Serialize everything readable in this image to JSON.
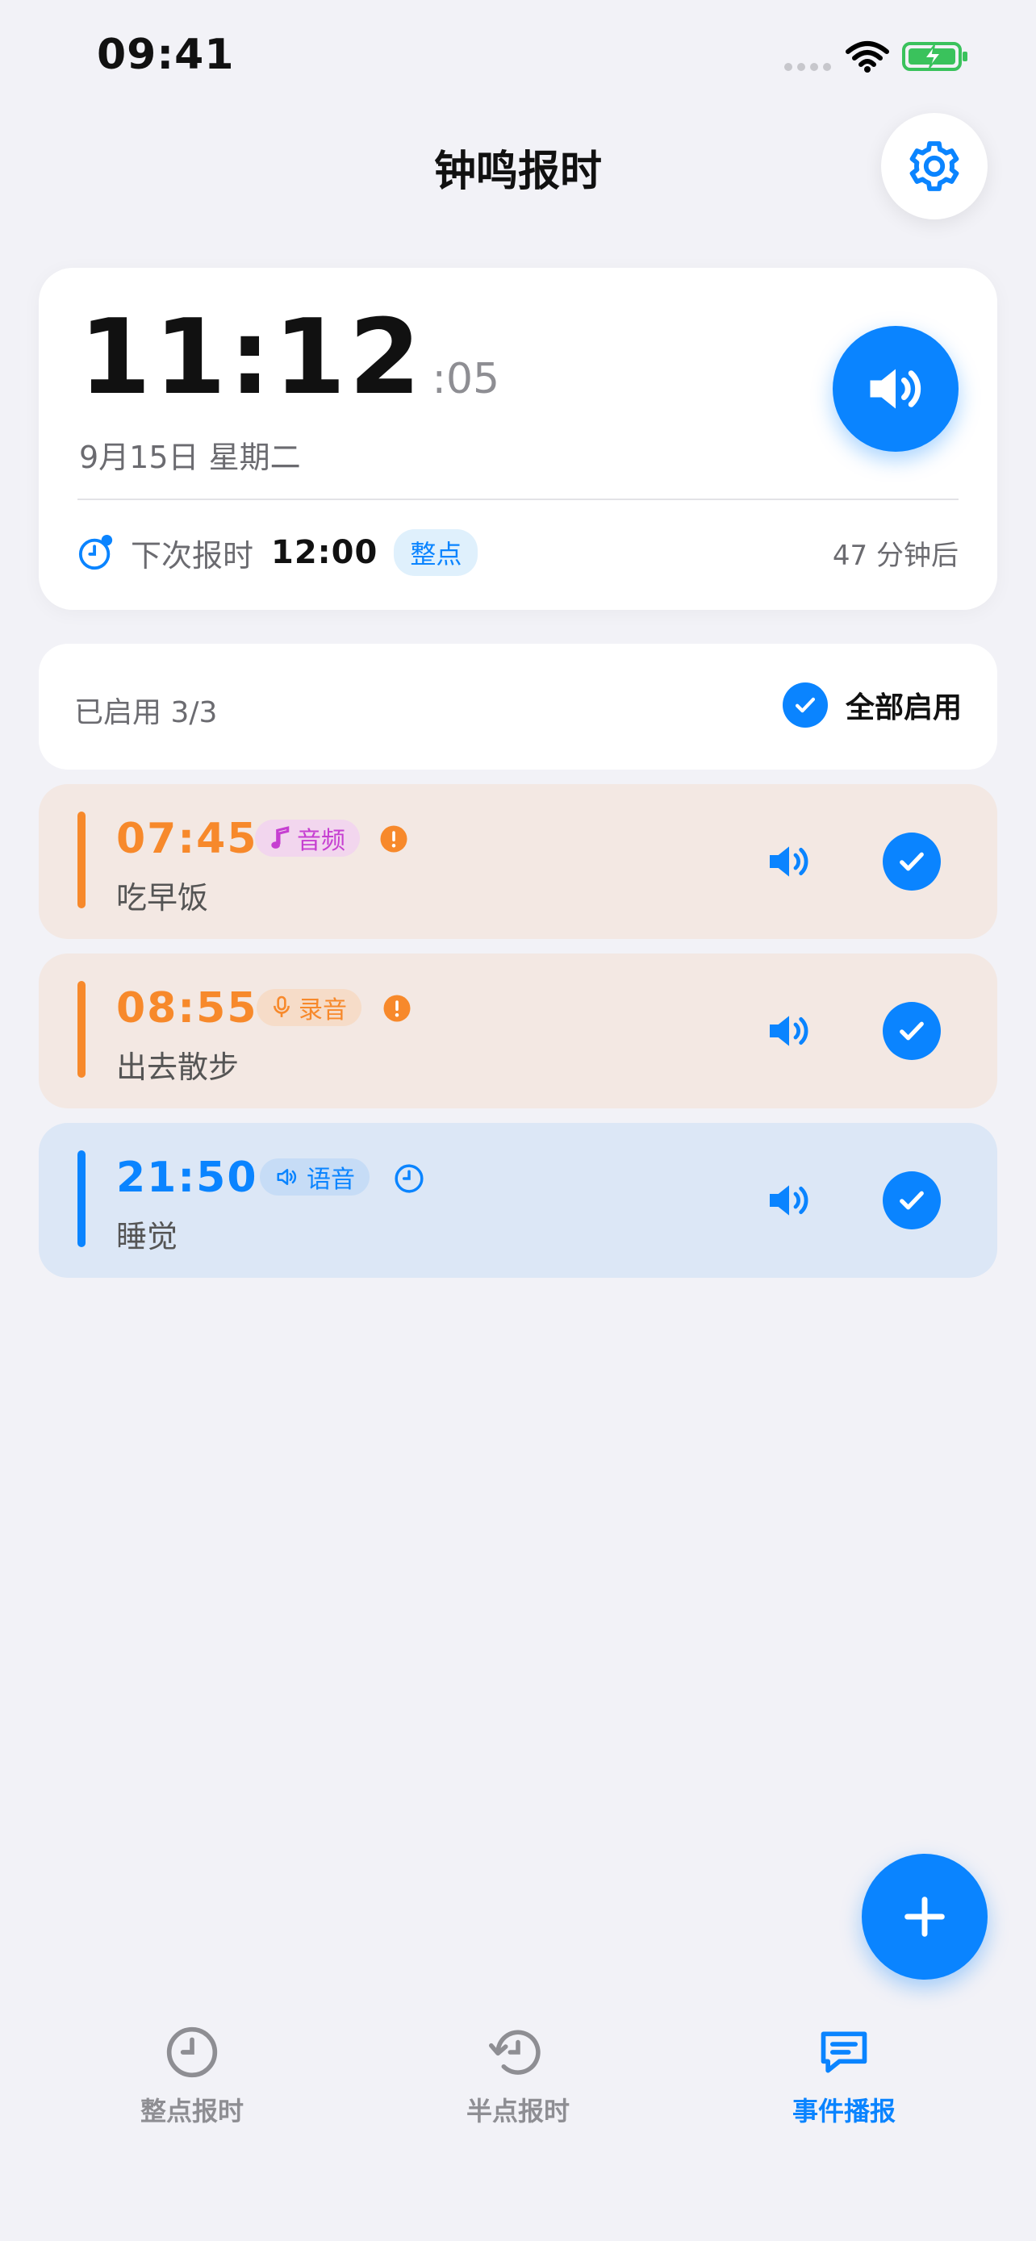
{
  "status_bar": {
    "time": "09:41"
  },
  "header": {
    "title": "钟鸣报时"
  },
  "clock": {
    "hours_minutes": "11:12",
    "seconds": ":05",
    "date": "9月15日 星期二",
    "next_label": "下次报时",
    "next_time": "12:00",
    "next_badge": "整点",
    "remaining": "47 分钟后"
  },
  "summary": {
    "enabled_count": "已启用 3/3",
    "toggle_all_label": "全部启用"
  },
  "events": [
    {
      "time": "07:45",
      "tag": "音频",
      "label": "吃早饭",
      "color": "#f7892b"
    },
    {
      "time": "08:55",
      "tag": "录音",
      "label": "出去散步",
      "color": "#f7892b"
    },
    {
      "time": "21:50",
      "tag": "语音",
      "label": "睡觉",
      "color": "#0a84ff"
    }
  ],
  "tabs": [
    {
      "label": "整点报时",
      "icon": "clock-icon"
    },
    {
      "label": "半点报时",
      "icon": "history-icon"
    },
    {
      "label": "事件播报",
      "icon": "message-icon"
    }
  ],
  "colors": {
    "accent": "#0a84ff",
    "warning": "#f7892b",
    "audio_tag": "#c63fd1"
  }
}
